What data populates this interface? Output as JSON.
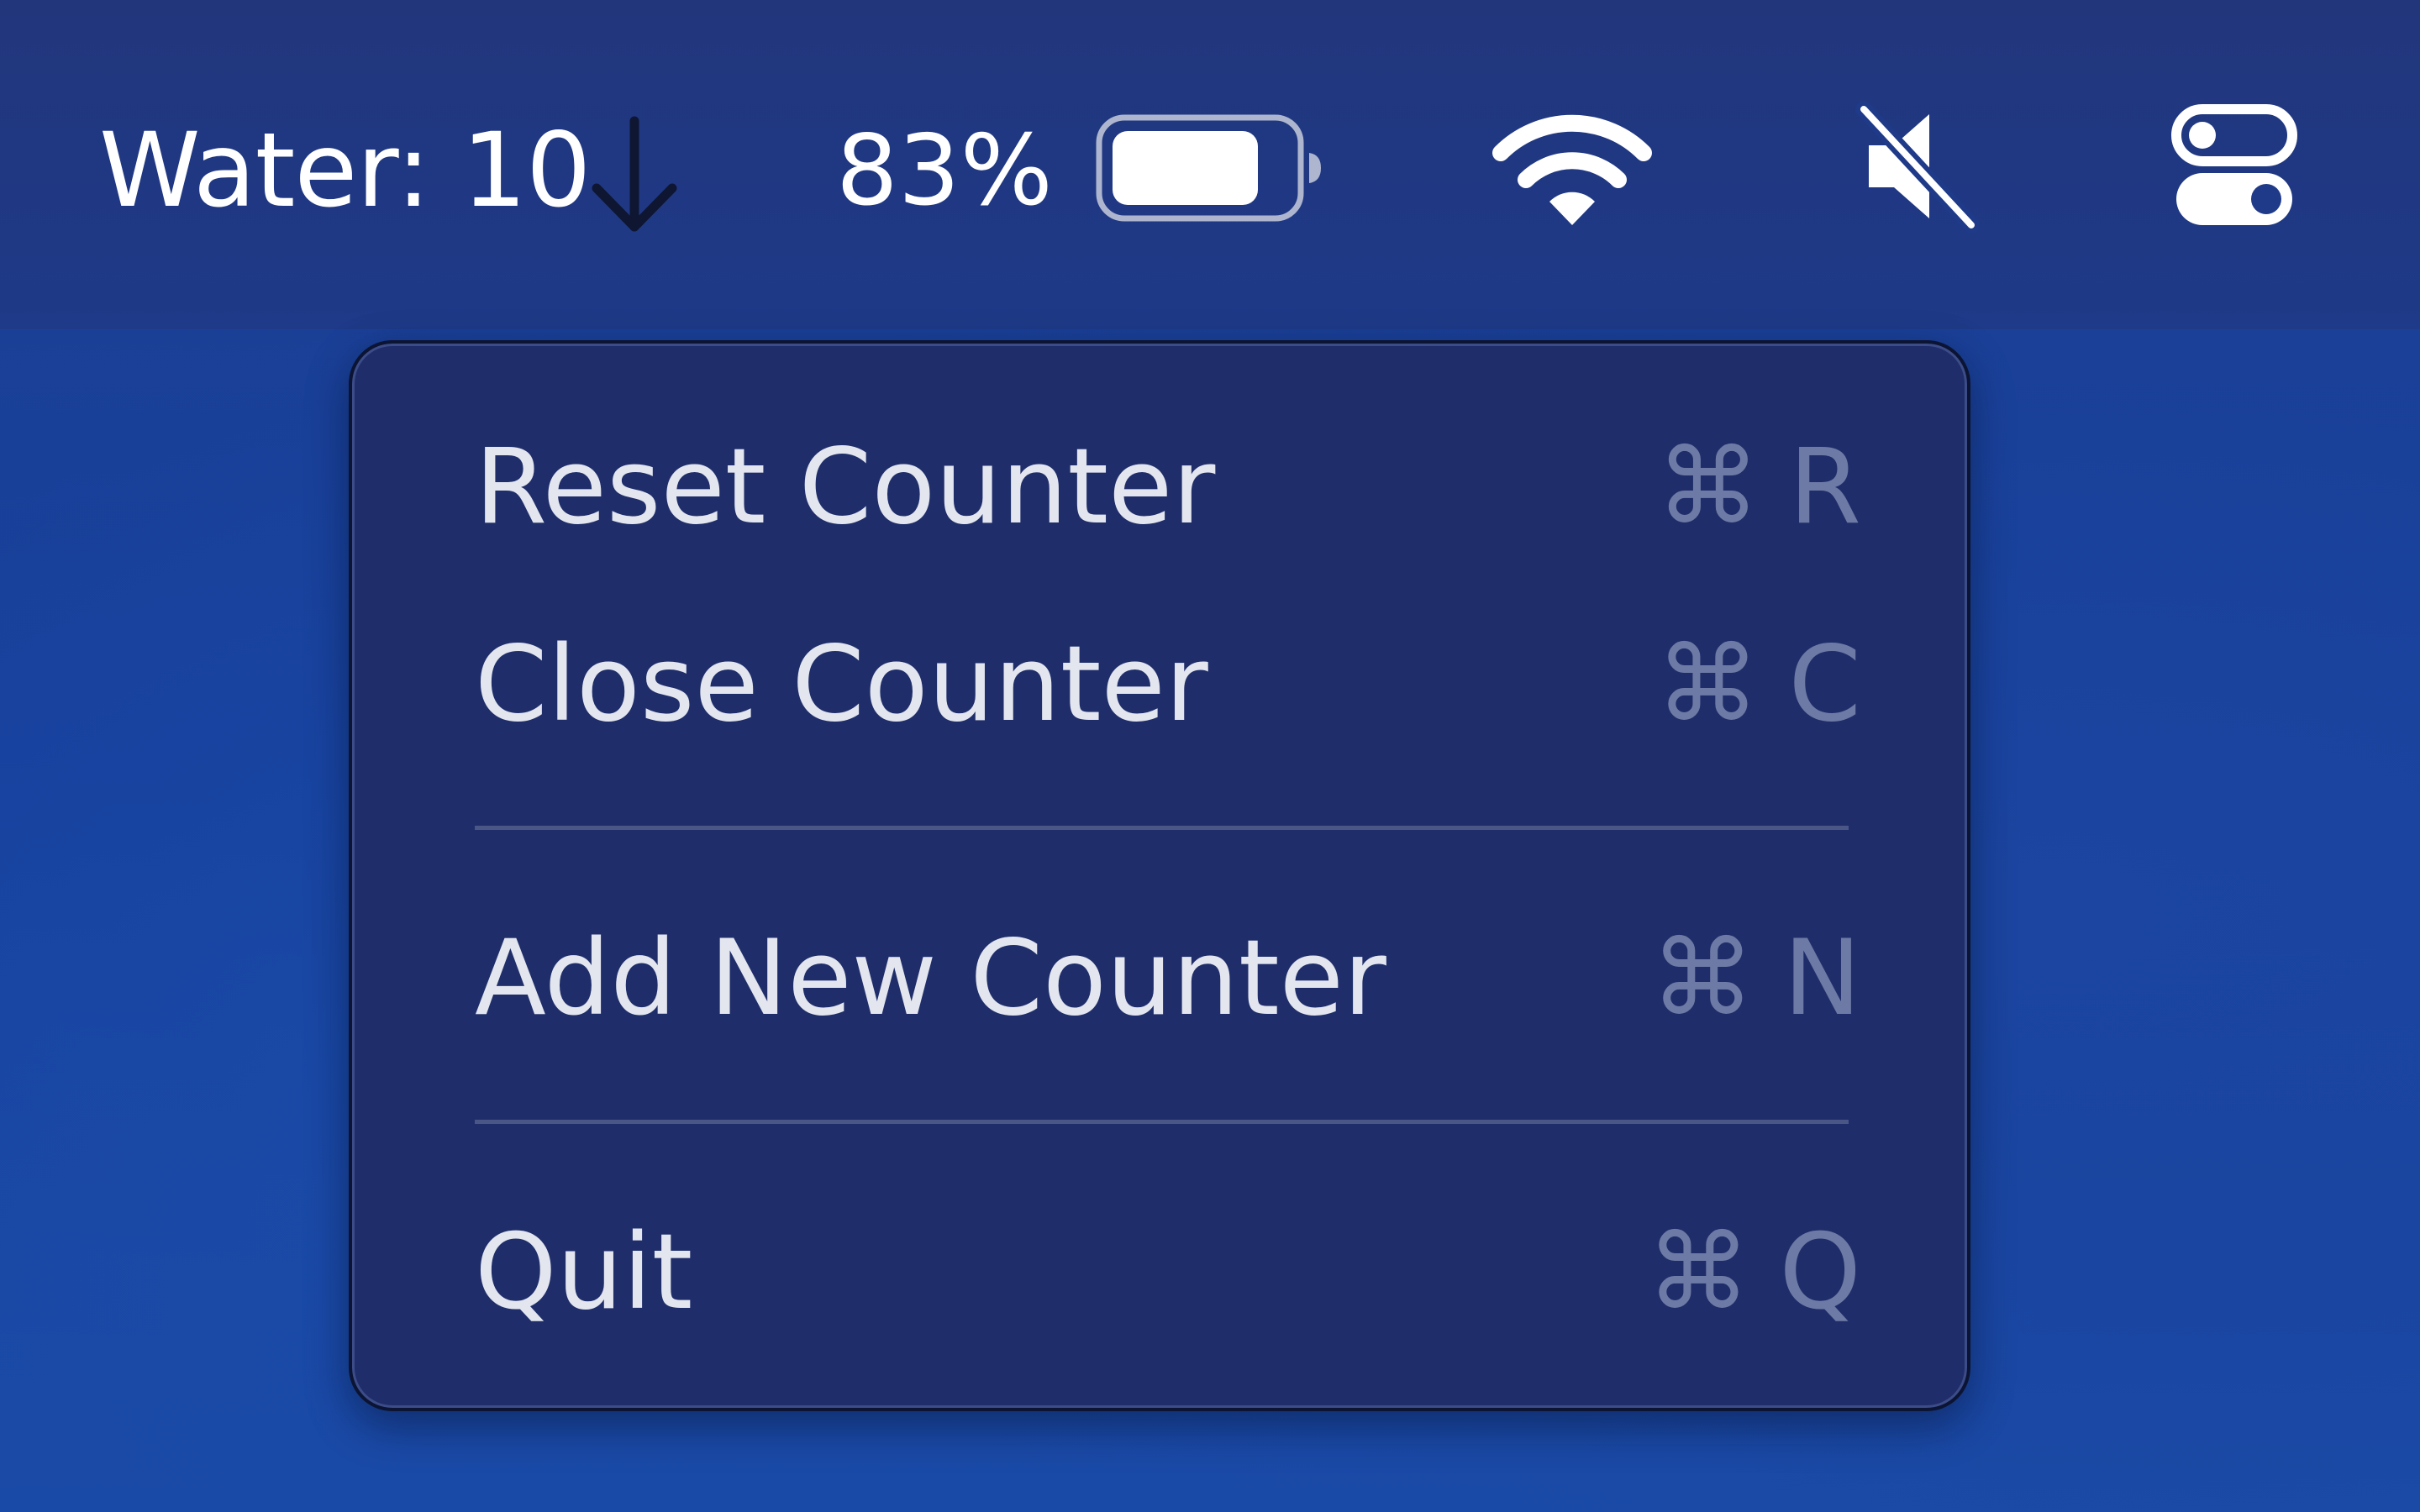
{
  "menubar": {
    "counter_label": "Water: 10",
    "counter_icon": "down-arrow-icon",
    "battery_percent": "83%",
    "battery_level": 0.83,
    "icons": [
      "battery-icon",
      "wifi-icon",
      "speaker-muted-icon",
      "control-center-icon"
    ]
  },
  "menu": {
    "items": [
      {
        "label": "Reset Counter",
        "shortcut_symbol": "⌘",
        "shortcut_key": "R"
      },
      {
        "label": "Close Counter",
        "shortcut_symbol": "⌘",
        "shortcut_key": "C"
      },
      {
        "label": "Add New Counter",
        "shortcut_symbol": "⌘",
        "shortcut_key": "N"
      },
      {
        "label": "Quit",
        "shortcut_symbol": "⌘",
        "shortcut_key": "Q"
      }
    ]
  },
  "colors": {
    "menubar_bg": "#22367c",
    "desktop_bg": "#1a4aa6",
    "menu_bg": "#1f2e6a",
    "menu_text": "#e3e6ef",
    "shortcut_text": "#6e7aa6"
  }
}
